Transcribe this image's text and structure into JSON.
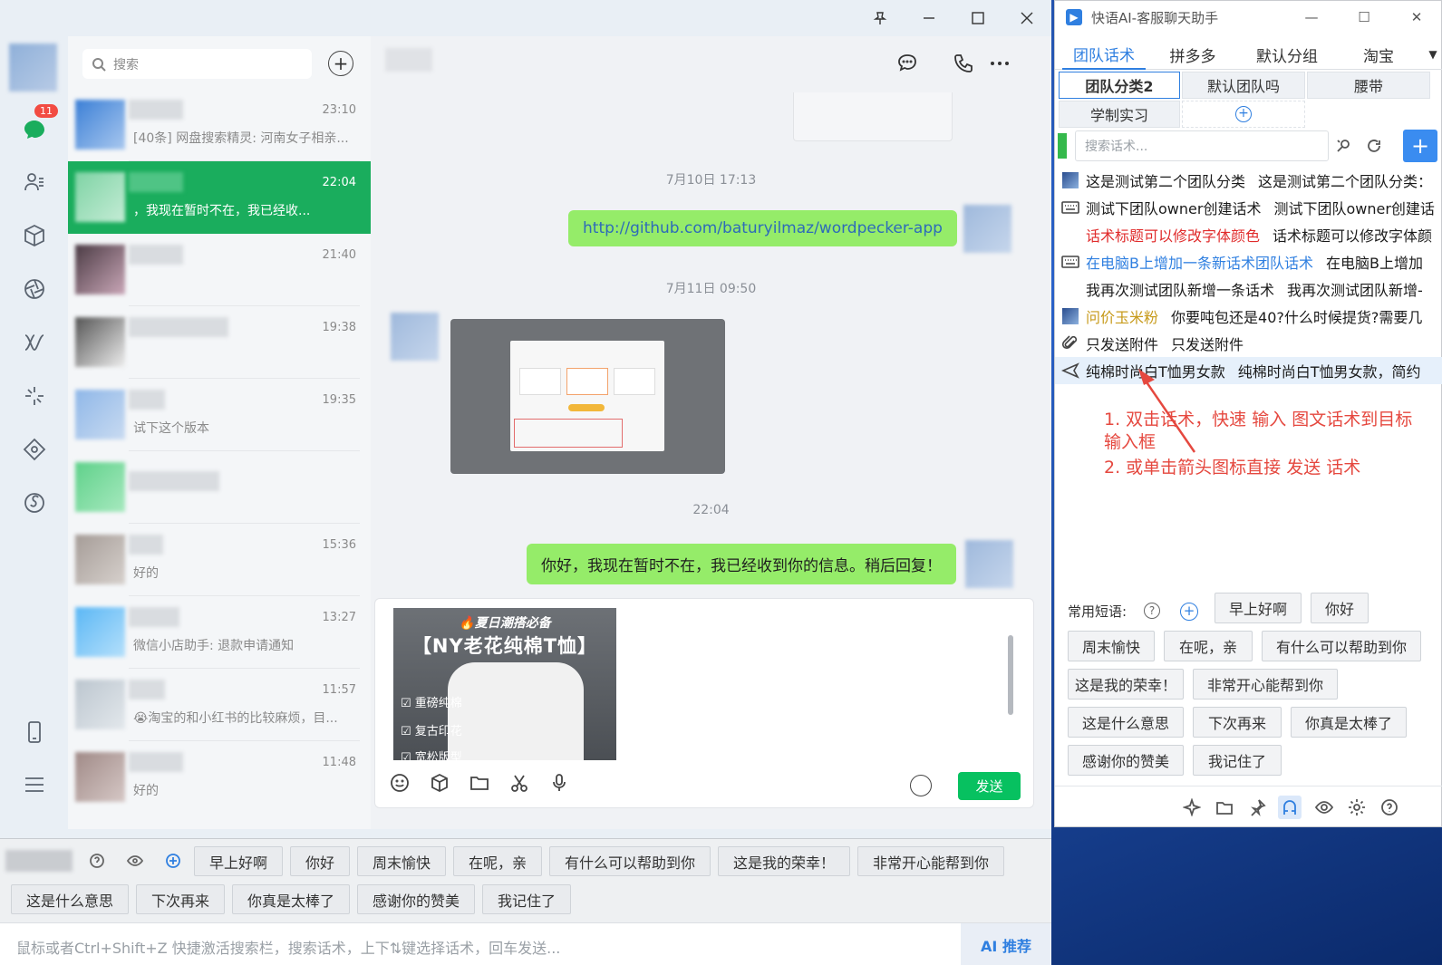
{
  "wechat": {
    "window_controls": [
      "pin-icon",
      "minimize-icon",
      "maximize-icon",
      "close-icon"
    ],
    "nav": {
      "unread_badge": "11"
    },
    "search": {
      "placeholder": "搜索"
    },
    "conversations": [
      {
        "time": "23:10",
        "preview": "[40条] 网盘搜索精灵: 河南女子相亲..."
      },
      {
        "time": "22:04",
        "preview": "，我现在暂时不在，我已经收...",
        "active": true
      },
      {
        "time": "21:40",
        "preview": ""
      },
      {
        "time": "19:38",
        "preview": ""
      },
      {
        "time": "19:35",
        "preview": "试下这个版本"
      },
      {
        "time": "",
        "preview": ""
      },
      {
        "time": "15:36",
        "preview": "好的"
      },
      {
        "time": "13:27",
        "preview": "微信小店助手: 退款申请通知"
      },
      {
        "time": "11:57",
        "preview": "😭淘宝的和小红书的比较麻烦，目..."
      },
      {
        "time": "11:48",
        "preview": "好的"
      }
    ],
    "chat": {
      "messages": [
        {
          "type": "time",
          "text": "7月10日 17:13"
        },
        {
          "type": "out",
          "text": "http://github.com/baturyilmaz/wordpecker-app"
        },
        {
          "type": "time",
          "text": "7月11日 09:50"
        },
        {
          "type": "time",
          "text": "22:04"
        },
        {
          "type": "out",
          "text": "你好，我现在暂时不在，我已经收到你的信息。稍后回复！"
        }
      ],
      "input_image": {
        "line1": "🔥夏日潮搭必备",
        "line2": "【NY老花纯棉T恤】",
        "checks": [
          "☑ 重磅纯棉",
          "☑ 复古印花",
          "☑ 宽松版型"
        ]
      },
      "send_label": "发送"
    }
  },
  "bottom_bar": {
    "row1": [
      "早上好啊",
      "你好",
      "周末愉快",
      "在呢，亲",
      "有什么可以帮助到你",
      "这是我的荣幸！",
      "非常开心能帮到你"
    ],
    "row2": [
      "这是什么意思",
      "下次再来",
      "你真是太棒了",
      "感谢你的赞美",
      "我记住了"
    ],
    "hint": "鼠标或者Ctrl+Shift+Z 快捷激活搜索栏，搜索话术，上下⇅键选择话术，回车发送...",
    "ai_label": "AI 推荐"
  },
  "assistant": {
    "title": "快语AI-客服聊天助手",
    "tabs": [
      "团队话术",
      "拼多多",
      "默认分组",
      "淘宝"
    ],
    "subtabs": [
      "团队分类2",
      "默认团队吗",
      "腰带",
      "学制实习"
    ],
    "search_placeholder": "搜索话术...",
    "scripts": [
      {
        "icon": "image-icon",
        "title": "这是测试第二个团队分类",
        "content": "这是测试第二个团队分类：",
        "color": "#1b1b1b"
      },
      {
        "icon": "keyboard-icon",
        "title": "测试下团队owner创建话术",
        "content": "测试下团队owner创建话",
        "color": "#1b1b1b"
      },
      {
        "icon": "",
        "title": "话术标题可以修改字体颜色",
        "content": "话术标题可以修改字体颜",
        "color": "#e02b2b"
      },
      {
        "icon": "keyboard-icon",
        "title": "在电脑B上增加一条新话术团队话术",
        "content": "在电脑B上增加",
        "color": "#2f7fe0"
      },
      {
        "icon": "",
        "title": "我再次测试团队新增一条话术",
        "content": "我再次测试团队新增-",
        "color": "#1b1b1b"
      },
      {
        "icon": "image-icon",
        "title": "问价玉米粉",
        "content": "你要吨包还是40?什么时候提货?需要几",
        "color": "#c79a1a"
      },
      {
        "icon": "paperclip-icon",
        "title": "只发送附件",
        "content": "只发送附件",
        "color": "#1b1b1b"
      },
      {
        "icon": "send-arrow-icon",
        "title": "纯棉时尚白T恤男女款",
        "content": "纯棉时尚白T恤男女款，简约",
        "color": "#1b1b1b",
        "selected": true
      }
    ],
    "annotation": {
      "line1": "1. 双击话术，快速 输入 图文话术到目标",
      "line2": "输入框",
      "line3": "2. 或单击箭头图标直接 发送 话术"
    },
    "common_label": "常用短语:",
    "common_first": [
      "早上好啊",
      "你好"
    ],
    "common_rows": [
      [
        "周末愉快",
        "在呢，亲",
        "有什么可以帮助到你"
      ],
      [
        "这是我的荣幸！",
        "非常开心能帮到你"
      ],
      [
        "这是什么意思",
        "下次再来",
        "你真是太棒了"
      ],
      [
        "感谢你的赞美",
        "我记住了"
      ]
    ]
  }
}
